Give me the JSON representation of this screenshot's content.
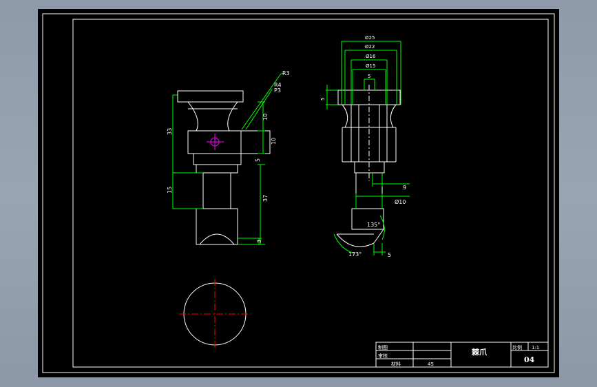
{
  "colors": {
    "background": "#000000",
    "outline": "#ffffff",
    "dimension": "#00ff00",
    "centerline": "#ff0000",
    "center_mark": "#ff00ff"
  },
  "front_view": {
    "dims": {
      "r3_top": "R3",
      "r4": "R4",
      "p3": "P3",
      "h33": "33",
      "h15": "15",
      "h10a": "10",
      "h10b": "10",
      "h5": "5",
      "h37": "37",
      "h3": "3"
    }
  },
  "side_view": {
    "dims": {
      "d25": "Ø25",
      "d22": "Ø22",
      "d16": "Ø16",
      "d15": "Ø15",
      "w5": "5",
      "h5": "5",
      "w9": "9",
      "d10": "Ø10",
      "a135": "135°",
      "a173": "173°",
      "w5b": "5"
    }
  },
  "title_block": {
    "drawn_by": "制图",
    "checked_by": "审核",
    "material_label": "材料",
    "material_value": "45",
    "part_name": "棘爪",
    "scale_label": "比例",
    "scale_value": "1:1",
    "drawing_no": "04"
  }
}
